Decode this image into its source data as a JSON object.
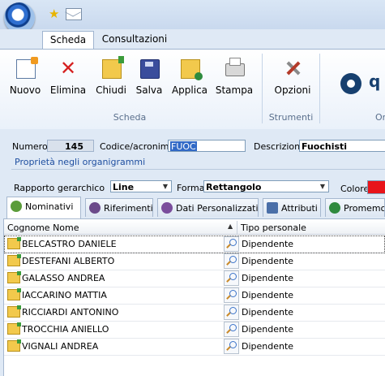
{
  "window": {
    "quick_access_icons": [
      "star-icon",
      "mail-icon"
    ]
  },
  "ribbon": {
    "tabs": [
      {
        "label": "Scheda",
        "active": true
      },
      {
        "label": "Consultazioni",
        "active": false
      }
    ],
    "buttons": [
      {
        "label": "Nuovo",
        "icon": "new-record-icon"
      },
      {
        "label": "Elimina",
        "icon": "delete-icon"
      },
      {
        "label": "Chiudi",
        "icon": "close-folder-icon"
      },
      {
        "label": "Salva",
        "icon": "save-icon"
      },
      {
        "label": "Applica",
        "icon": "apply-icon"
      },
      {
        "label": "Stampa",
        "icon": "print-icon"
      },
      {
        "label": "Opzioni",
        "icon": "tools-icon"
      }
    ],
    "groups": {
      "scheda": "Scheda",
      "strumenti": "Strumenti",
      "cut": "Or"
    },
    "logo_letter": "q"
  },
  "form": {
    "numero_label": "Numero",
    "numero_value": "145",
    "codice_label": "Codice/acronimo",
    "codice_value": "FUOC",
    "descrizione_label": "Descrizione",
    "descrizione_value": "Fuochisti",
    "link_org": "Proprietà negli organigrammi",
    "rapporto_label": "Rapporto gerarchico",
    "rapporto_value": "Line",
    "forma_label": "Forma",
    "forma_value": "Rettangolo",
    "colore_label": "Colore",
    "colore_value": "#e8141a"
  },
  "tabs": [
    {
      "label": "Nominativi",
      "active": true
    },
    {
      "label": "Riferimenti",
      "active": false
    },
    {
      "label": "Dati Personalizzati",
      "active": false
    },
    {
      "label": "Attributi",
      "active": false
    },
    {
      "label": "Promemoria",
      "active": false
    }
  ],
  "grid": {
    "columns": [
      "Cognome Nome",
      "Tipo personale"
    ],
    "rows": [
      {
        "name": "BELCASTRO DANIELE",
        "tipo": "Dipendente",
        "selected": true
      },
      {
        "name": "DESTEFANI ALBERTO",
        "tipo": "Dipendente"
      },
      {
        "name": "GALASSO ANDREA",
        "tipo": "Dipendente"
      },
      {
        "name": "IACCARINO MATTIA",
        "tipo": "Dipendente"
      },
      {
        "name": "RICCIARDI ANTONINO",
        "tipo": "Dipendente"
      },
      {
        "name": "TROCCHIA ANIELLO",
        "tipo": "Dipendente"
      },
      {
        "name": "VIGNALI ANDREA",
        "tipo": "Dipendente"
      }
    ]
  }
}
